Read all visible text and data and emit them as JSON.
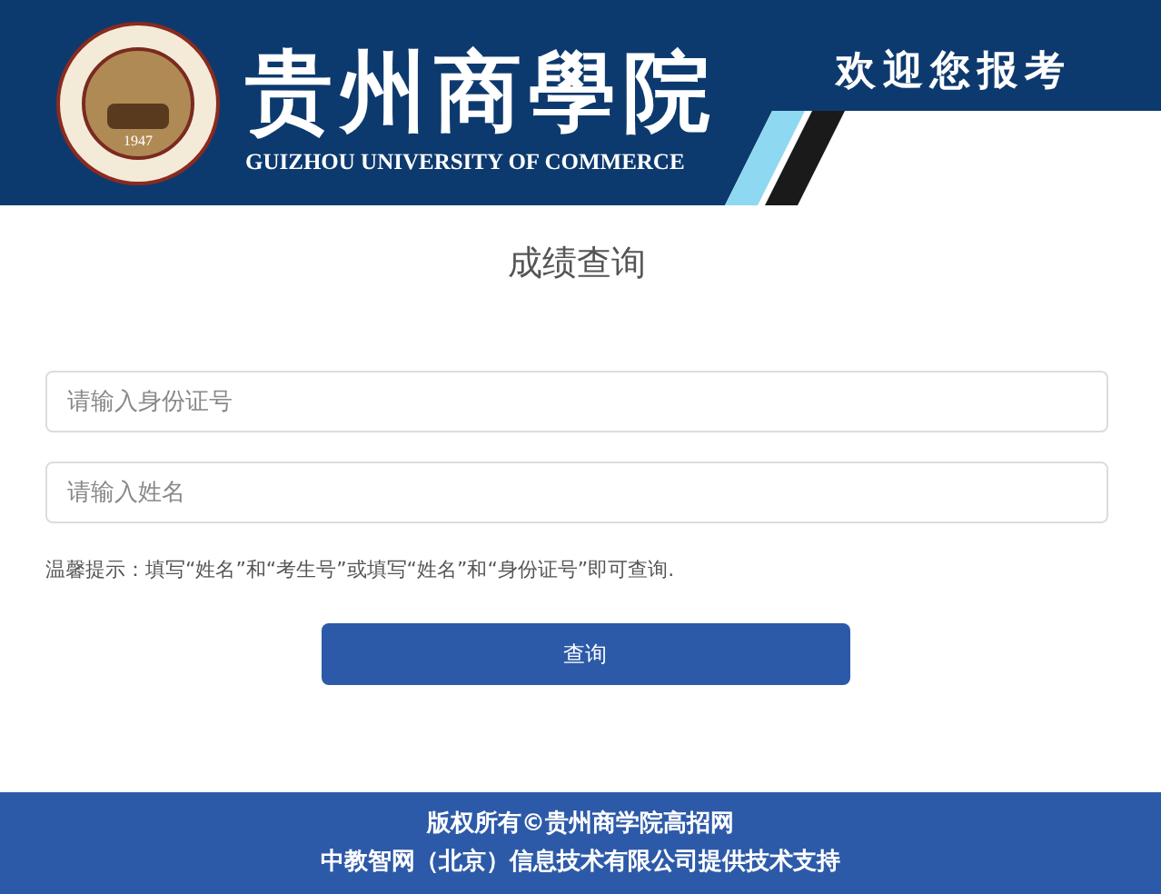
{
  "header": {
    "seal_year": "1947",
    "school_name": "贵州商學院",
    "school_name_en": "GUIZHOU UNIVERSITY OF COMMERCE",
    "welcome": "欢迎您报考"
  },
  "form": {
    "title": "成绩查询",
    "fields": [
      {
        "placeholder": "请输入身份证号"
      },
      {
        "placeholder": "请输入姓名"
      }
    ],
    "hint": "温馨提示：填写“姓名”和“考生号”或填写“姓名”和“身份证号”即可查询.",
    "submit": "查询"
  },
  "footer": {
    "lines": [
      "版权所有©贵州商学院高招网",
      "中教智网（北京）信息技术有限公司提供技术支持"
    ]
  }
}
